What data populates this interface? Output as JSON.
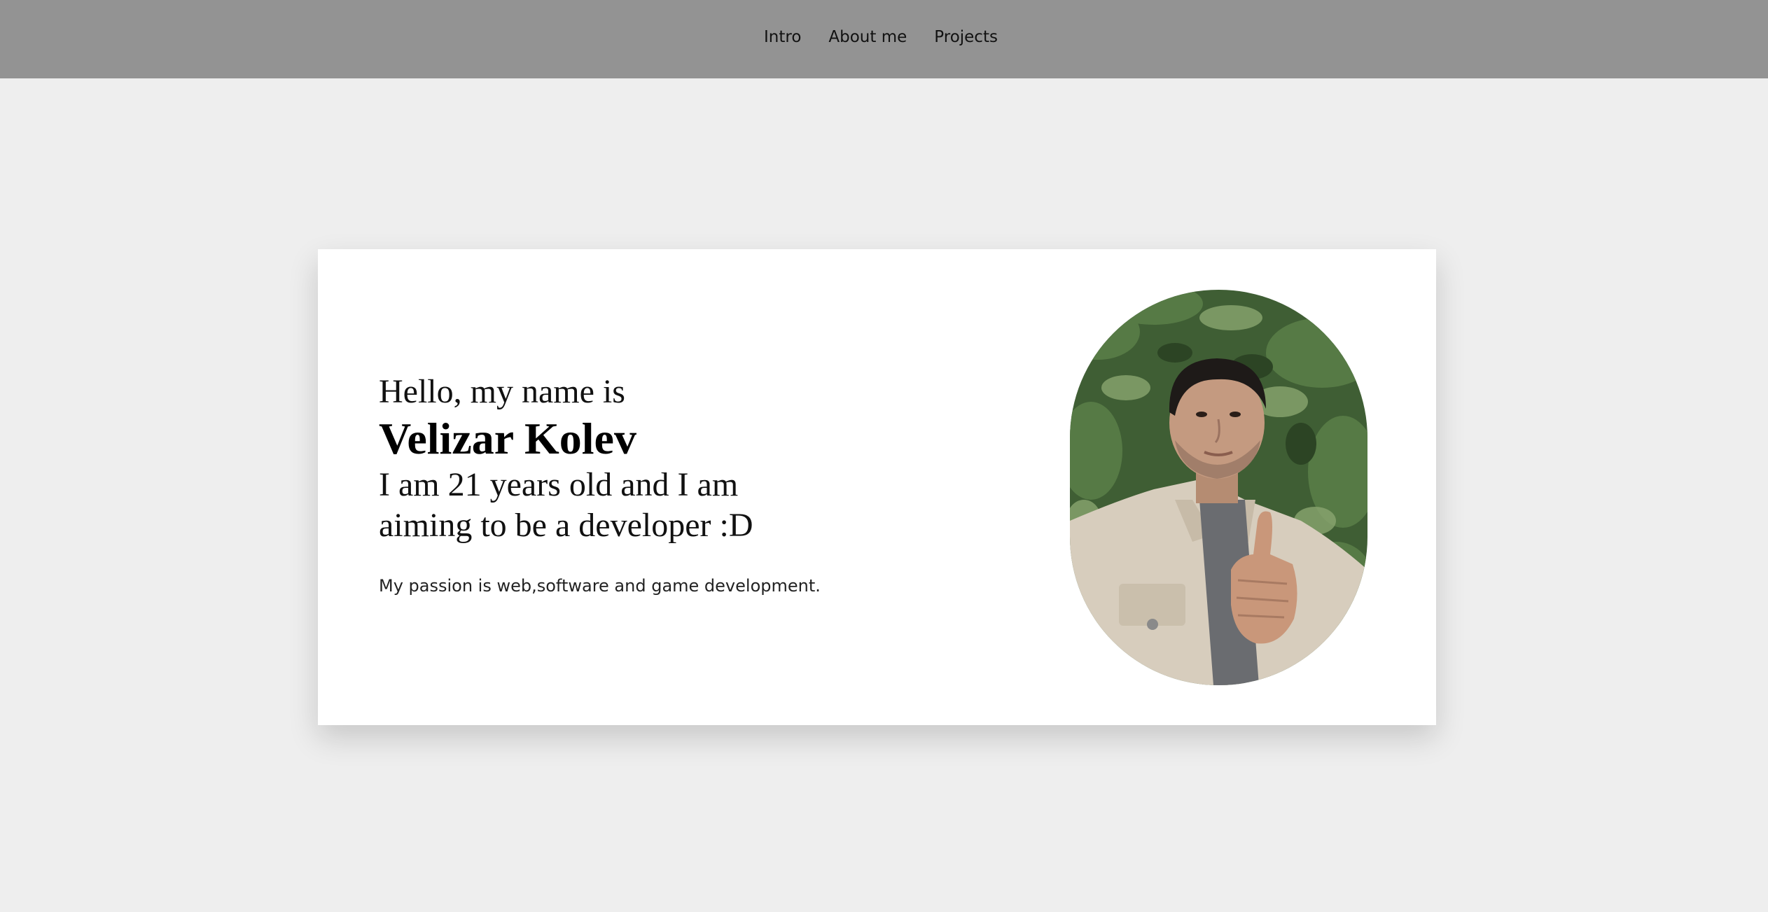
{
  "nav": {
    "items": [
      {
        "label": "Intro"
      },
      {
        "label": "About me"
      },
      {
        "label": "Projects"
      }
    ]
  },
  "hero": {
    "greeting": "Hello, my name is",
    "name": "Velizar Kolev",
    "tagline": "I am 21 years old and I am aiming to be a developer :D",
    "passion": "My passion is web,software and game development."
  },
  "colors": {
    "navbar_bg": "#939393",
    "page_bg": "#eeeeee",
    "card_bg": "#ffffff"
  }
}
